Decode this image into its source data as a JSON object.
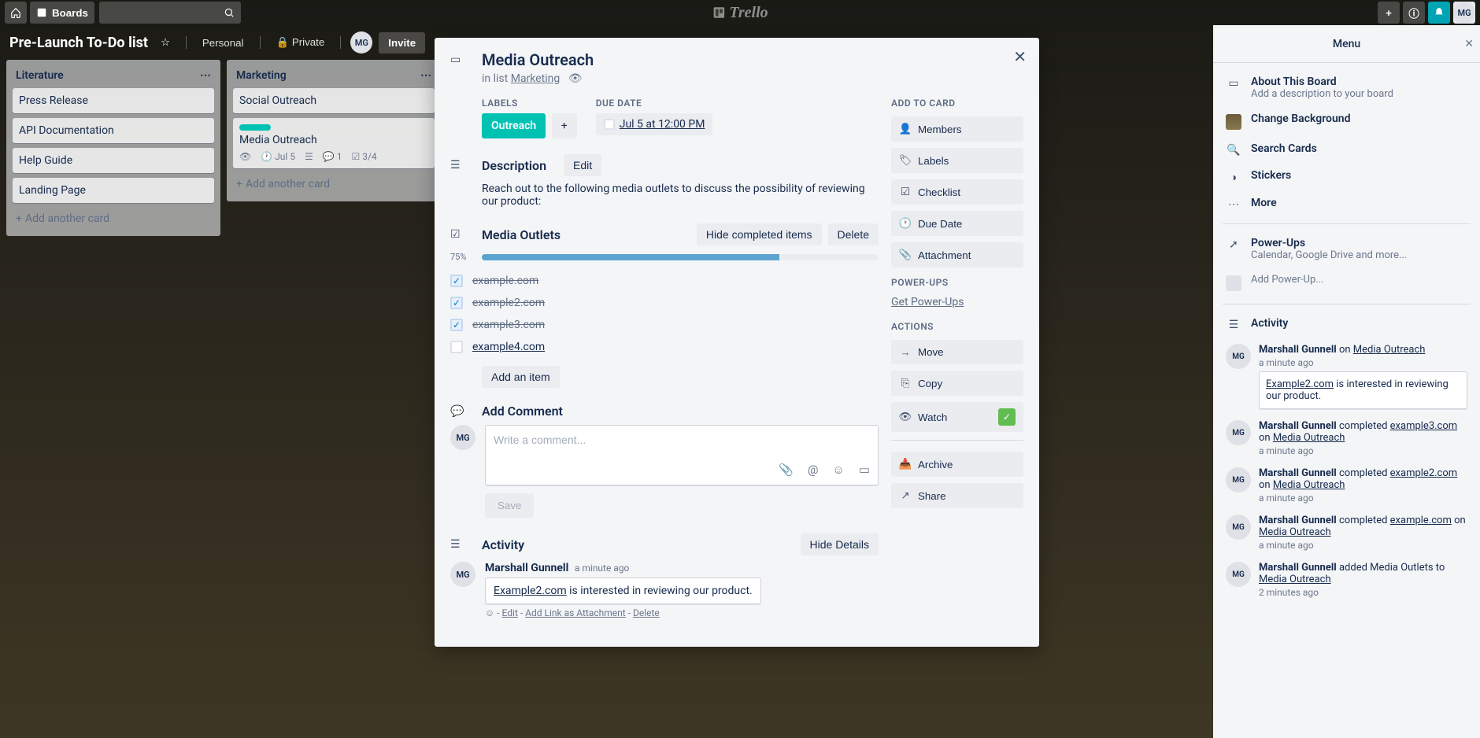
{
  "header": {
    "boards": "Boards",
    "logo": "Trello",
    "avatar": "MG"
  },
  "board_header": {
    "title": "Pre-Launch To-Do list",
    "personal": "Personal",
    "private": "Private",
    "avatar": "MG",
    "invite": "Invite"
  },
  "lists": [
    {
      "name": "Literature",
      "cards": [
        "Press Release",
        "API Documentation",
        "Help Guide",
        "Landing Page"
      ],
      "add": "Add another card"
    },
    {
      "name": "Marketing",
      "cards": [
        {
          "title": "Social Outreach"
        },
        {
          "title": "Media Outreach",
          "label": true,
          "badges": {
            "date": "Jul 5",
            "comments": "1",
            "check": "3/4"
          }
        }
      ],
      "add": "Add another card"
    }
  ],
  "modal": {
    "title": "Media Outreach",
    "in_list": "in list",
    "list_name": "Marketing",
    "labels_label": "LABELS",
    "label_name": "Outreach",
    "due_label": "DUE DATE",
    "due_date": "Jul 5 at 12:00 PM",
    "desc_head": "Description",
    "edit": "Edit",
    "desc_text": "Reach out to the following media outlets to discuss the possibility of reviewing our product:",
    "checklist_name": "Media Outlets",
    "hide_completed": "Hide completed items",
    "delete": "Delete",
    "pct": "75%",
    "items": [
      {
        "text": "example.com",
        "done": true
      },
      {
        "text": "example2.com",
        "done": true
      },
      {
        "text": "example3.com",
        "done": true
      },
      {
        "text": "example4.com",
        "done": false
      }
    ],
    "add_item": "Add an item",
    "add_comment": "Add Comment",
    "comment_placeholder": "Write a comment...",
    "save": "Save",
    "activity_head": "Activity",
    "hide_details": "Hide Details",
    "side": {
      "add_to_card": "ADD TO CARD",
      "members": "Members",
      "labels": "Labels",
      "checklist": "Checklist",
      "due_date": "Due Date",
      "attachment": "Attachment",
      "power_ups": "POWER-UPS",
      "get_pu": "Get Power-Ups",
      "actions": "ACTIONS",
      "move": "Move",
      "copy": "Copy",
      "watch": "Watch",
      "archive": "Archive",
      "share": "Share"
    },
    "activity": {
      "name": "Marshall Gunnell",
      "ts": "a minute ago",
      "link": "Example2.com",
      "text": " is interested in reviewing our product.",
      "edit": "Edit",
      "attach": "Add Link as Attachment",
      "del": "Delete"
    },
    "avatar": "MG"
  },
  "menu": {
    "title": "Menu",
    "about_title": "About This Board",
    "about_sub": "Add a description to your board",
    "bg": "Change Background",
    "search": "Search Cards",
    "stickers": "Stickers",
    "more": "More",
    "pu_title": "Power-Ups",
    "pu_sub": "Calendar, Google Drive and more...",
    "add_pu": "Add Power-Up...",
    "activity": "Activity",
    "acts": [
      {
        "name": "Marshall Gunnell",
        "verb": " on ",
        "link": "Media Outreach",
        "ts": "a minute ago",
        "comment_link": "Example2.com",
        "comment_rest": " is interested in reviewing our product."
      },
      {
        "name": "Marshall Gunnell",
        "verb": " completed ",
        "obj": "example3.com",
        "on": " on ",
        "link": "Media Outreach",
        "ts": "a minute ago"
      },
      {
        "name": "Marshall Gunnell",
        "verb": " completed ",
        "obj": "example2.com",
        "on": " on ",
        "link": "Media Outreach",
        "ts": "a minute ago"
      },
      {
        "name": "Marshall Gunnell",
        "verb": " completed ",
        "obj": "example.com",
        "on": " on ",
        "link": "Media Outreach",
        "ts": "a minute ago"
      },
      {
        "name": "Marshall Gunnell",
        "verb": " added Media Outlets to ",
        "link": "Media Outreach",
        "ts": "2 minutes ago"
      }
    ],
    "avatar": "MG"
  }
}
